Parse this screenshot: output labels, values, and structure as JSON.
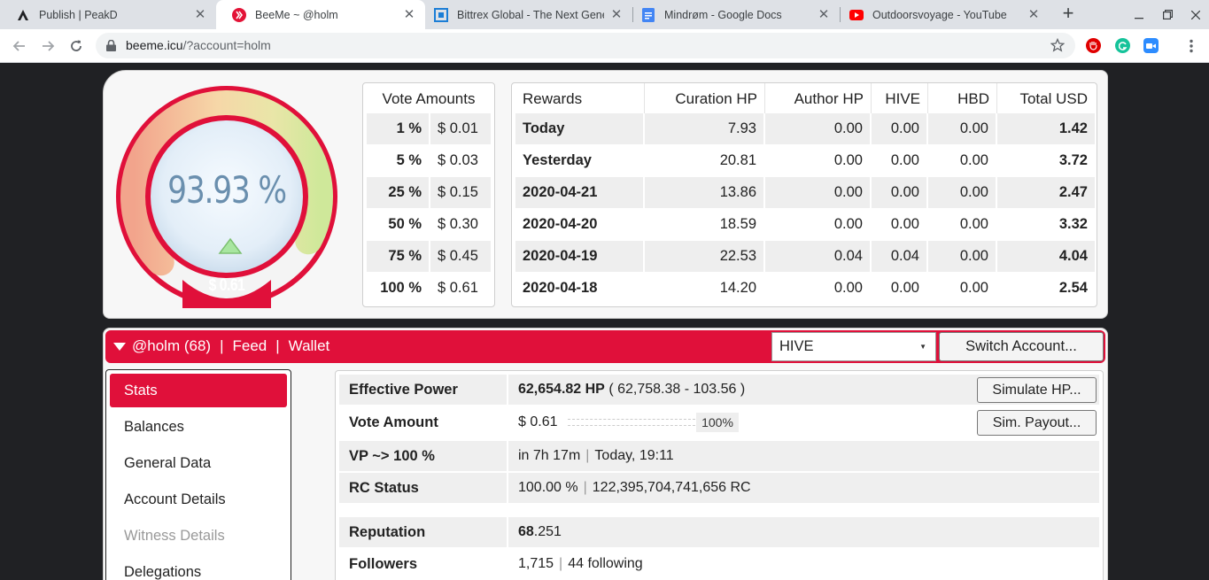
{
  "browser": {
    "tabs": [
      {
        "title": "Publish | PeakD",
        "icon": "peakd-icon"
      },
      {
        "title": "BeeMe ~ @holm",
        "icon": "hive-icon"
      },
      {
        "title": "Bittrex Global - The Next Genera",
        "icon": "bittrex-icon"
      },
      {
        "title": "Mindrøm - Google Docs",
        "icon": "docs-icon"
      },
      {
        "title": "Outdoorsvoyage - YouTube",
        "icon": "youtube-icon"
      }
    ],
    "active_tab": 1,
    "url_host": "beeme.icu",
    "url_path": "/?account=holm"
  },
  "gauge": {
    "vp_percent_text": "93.93 %",
    "vp_fraction": 0.9393,
    "vote_usd": "$ 0.61",
    "accent_color": "#e0103a"
  },
  "vote_amounts": {
    "header": "Vote Amounts",
    "rows": [
      {
        "pct": "1 %",
        "usd": "$ 0.01"
      },
      {
        "pct": "5 %",
        "usd": "$ 0.03"
      },
      {
        "pct": "25 %",
        "usd": "$ 0.15"
      },
      {
        "pct": "50 %",
        "usd": "$ 0.30"
      },
      {
        "pct": "75 %",
        "usd": "$ 0.45"
      },
      {
        "pct": "100 %",
        "usd": "$ 0.61"
      }
    ]
  },
  "rewards": {
    "headers": [
      "Rewards",
      "Curation HP",
      "Author HP",
      "HIVE",
      "HBD",
      "Total USD"
    ],
    "rows": [
      [
        "Today",
        "7.93",
        "0.00",
        "0.00",
        "0.00",
        "1.42"
      ],
      [
        "Yesterday",
        "20.81",
        "0.00",
        "0.00",
        "0.00",
        "3.72"
      ],
      [
        "2020-04-21",
        "13.86",
        "0.00",
        "0.00",
        "0.00",
        "2.47"
      ],
      [
        "2020-04-20",
        "18.59",
        "0.00",
        "0.00",
        "0.00",
        "3.32"
      ],
      [
        "2020-04-19",
        "22.53",
        "0.04",
        "0.04",
        "0.00",
        "4.04"
      ],
      [
        "2020-04-18",
        "14.20",
        "0.00",
        "0.00",
        "0.00",
        "2.54"
      ]
    ]
  },
  "account_bar": {
    "account": "@holm (68)",
    "feed": "Feed",
    "wallet": "Wallet",
    "separator": "|",
    "chain": "HIVE",
    "switch_label": "Switch Account..."
  },
  "menu": {
    "items": [
      "Stats",
      "Balances",
      "General Data",
      "Account Details",
      "Witness Details",
      "Delegations"
    ],
    "active": 0,
    "disabled": 4
  },
  "stats": {
    "effective_power_label": "Effective Power",
    "effective_power_value": "62,654.82 HP",
    "effective_power_detail": "( 62,758.38 - 103.56 )",
    "simulate_hp_label": "Simulate HP...",
    "vote_amount_label": "Vote Amount",
    "vote_amount_value": "$ 0.61",
    "vote_slider_label": "100%",
    "vote_slider_fraction": 1.0,
    "sim_payout_label": "Sim. Payout...",
    "vp_label": "VP ~> 100 %",
    "vp_time": "in 7h 17m",
    "vp_when": "Today, 19:11",
    "rc_label": "RC Status",
    "rc_percent": "100.00 %",
    "rc_value": "122,395,704,741,656 RC",
    "reputation_label": "Reputation",
    "reputation_int": "68",
    "reputation_dec": ".251",
    "followers_label": "Followers",
    "followers_count": "1,715",
    "following": "44 following",
    "pipe": "|"
  }
}
